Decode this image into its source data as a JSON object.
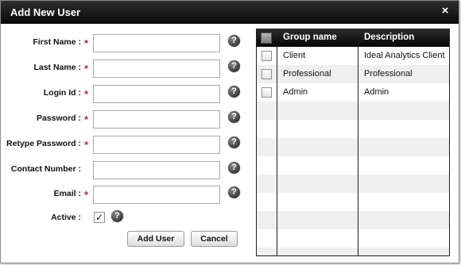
{
  "dialog": {
    "title": "Add New User",
    "close_glyph": "×"
  },
  "form": {
    "fields": [
      {
        "label": "First Name :",
        "required": true,
        "value": "",
        "help": "?"
      },
      {
        "label": "Last Name :",
        "required": true,
        "value": "",
        "help": "?"
      },
      {
        "label": "Login Id :",
        "required": true,
        "value": "",
        "help": "?"
      },
      {
        "label": "Password :",
        "required": true,
        "value": "",
        "help": "?"
      },
      {
        "label": "Retype Password :",
        "required": true,
        "value": "",
        "help": "?"
      },
      {
        "label": "Contact Number :",
        "required": false,
        "value": "",
        "help": "?"
      },
      {
        "label": "Email :",
        "required": true,
        "value": "",
        "help": "?"
      }
    ],
    "required_mark": "*",
    "active": {
      "label": "Active :",
      "checked": true,
      "check_glyph": "✓",
      "help": "?"
    },
    "add_label": "Add User",
    "cancel_label": "Cancel"
  },
  "groups": {
    "columns": [
      "Group name",
      "Description"
    ],
    "rows": [
      {
        "name": "Client",
        "description": "Ideal Analytics Client",
        "checked": false
      },
      {
        "name": "Professional",
        "description": "Professional",
        "checked": false
      },
      {
        "name": "Admin",
        "description": "Admin",
        "checked": false
      }
    ]
  },
  "colors": {
    "title_bar": "#111111",
    "required": "#d42323",
    "row_alt": "#efefef"
  }
}
